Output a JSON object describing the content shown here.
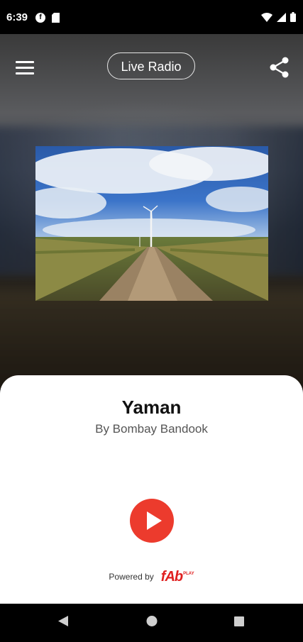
{
  "status_bar": {
    "time": "6:39",
    "icons": [
      "f-icon",
      "sd-card-icon",
      "wifi-icon",
      "cellular-signal-icon",
      "battery-icon"
    ]
  },
  "header": {
    "live_radio_label": "Live Radio",
    "menu_icon": "hamburger-menu-icon",
    "share_icon": "share-icon"
  },
  "now_playing": {
    "title": "Yaman",
    "artist": "By Bombay Bandook",
    "play_icon": "play-icon"
  },
  "footer": {
    "powered_by": "Powered by",
    "brand": "fAb",
    "brand_sub": "PLAY"
  },
  "colors": {
    "accent": "#ec3b2d",
    "panel_bg": "#ffffff",
    "brand_red": "#e02020"
  },
  "nav": {
    "icons": [
      "back-icon",
      "home-icon",
      "recents-icon"
    ]
  }
}
